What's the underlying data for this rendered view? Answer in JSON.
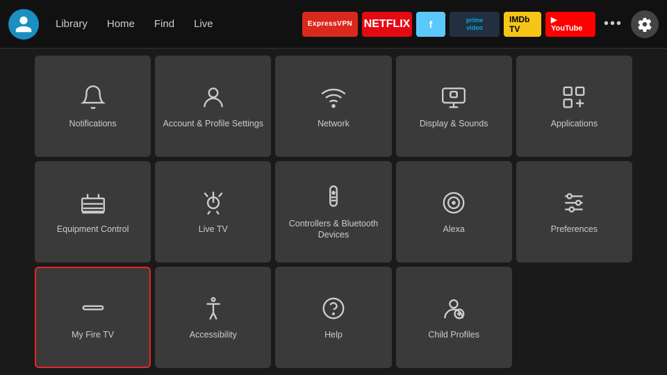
{
  "nav": {
    "links": [
      "Library",
      "Home",
      "Find",
      "Live"
    ],
    "apps": [
      {
        "label": "ExpressVPN",
        "class": "badge-expressvpn"
      },
      {
        "label": "NETFLIX",
        "class": "badge-netflix"
      },
      {
        "label": "f",
        "class": "badge-freevee"
      },
      {
        "label": "prime video",
        "class": "badge-prime"
      },
      {
        "label": "IMDb TV",
        "class": "badge-imdb"
      },
      {
        "label": "▶ YouTube",
        "class": "badge-youtube"
      }
    ],
    "more_label": "•••"
  },
  "tiles": [
    {
      "id": "notifications",
      "label": "Notifications",
      "icon": "bell",
      "selected": false
    },
    {
      "id": "account",
      "label": "Account & Profile Settings",
      "icon": "person",
      "selected": false
    },
    {
      "id": "network",
      "label": "Network",
      "icon": "wifi",
      "selected": false
    },
    {
      "id": "display",
      "label": "Display & Sounds",
      "icon": "display",
      "selected": false
    },
    {
      "id": "applications",
      "label": "Applications",
      "icon": "apps",
      "selected": false
    },
    {
      "id": "equipment",
      "label": "Equipment Control",
      "icon": "tv",
      "selected": false
    },
    {
      "id": "livetv",
      "label": "Live TV",
      "icon": "antenna",
      "selected": false
    },
    {
      "id": "controllers",
      "label": "Controllers & Bluetooth Devices",
      "icon": "remote",
      "selected": false
    },
    {
      "id": "alexa",
      "label": "Alexa",
      "icon": "alexa",
      "selected": false
    },
    {
      "id": "preferences",
      "label": "Preferences",
      "icon": "sliders",
      "selected": false
    },
    {
      "id": "myfiretv",
      "label": "My Fire TV",
      "icon": "firetv",
      "selected": true
    },
    {
      "id": "accessibility",
      "label": "Accessibility",
      "icon": "accessibility",
      "selected": false
    },
    {
      "id": "help",
      "label": "Help",
      "icon": "help",
      "selected": false
    },
    {
      "id": "childprofiles",
      "label": "Child Profiles",
      "icon": "childprofile",
      "selected": false
    }
  ]
}
